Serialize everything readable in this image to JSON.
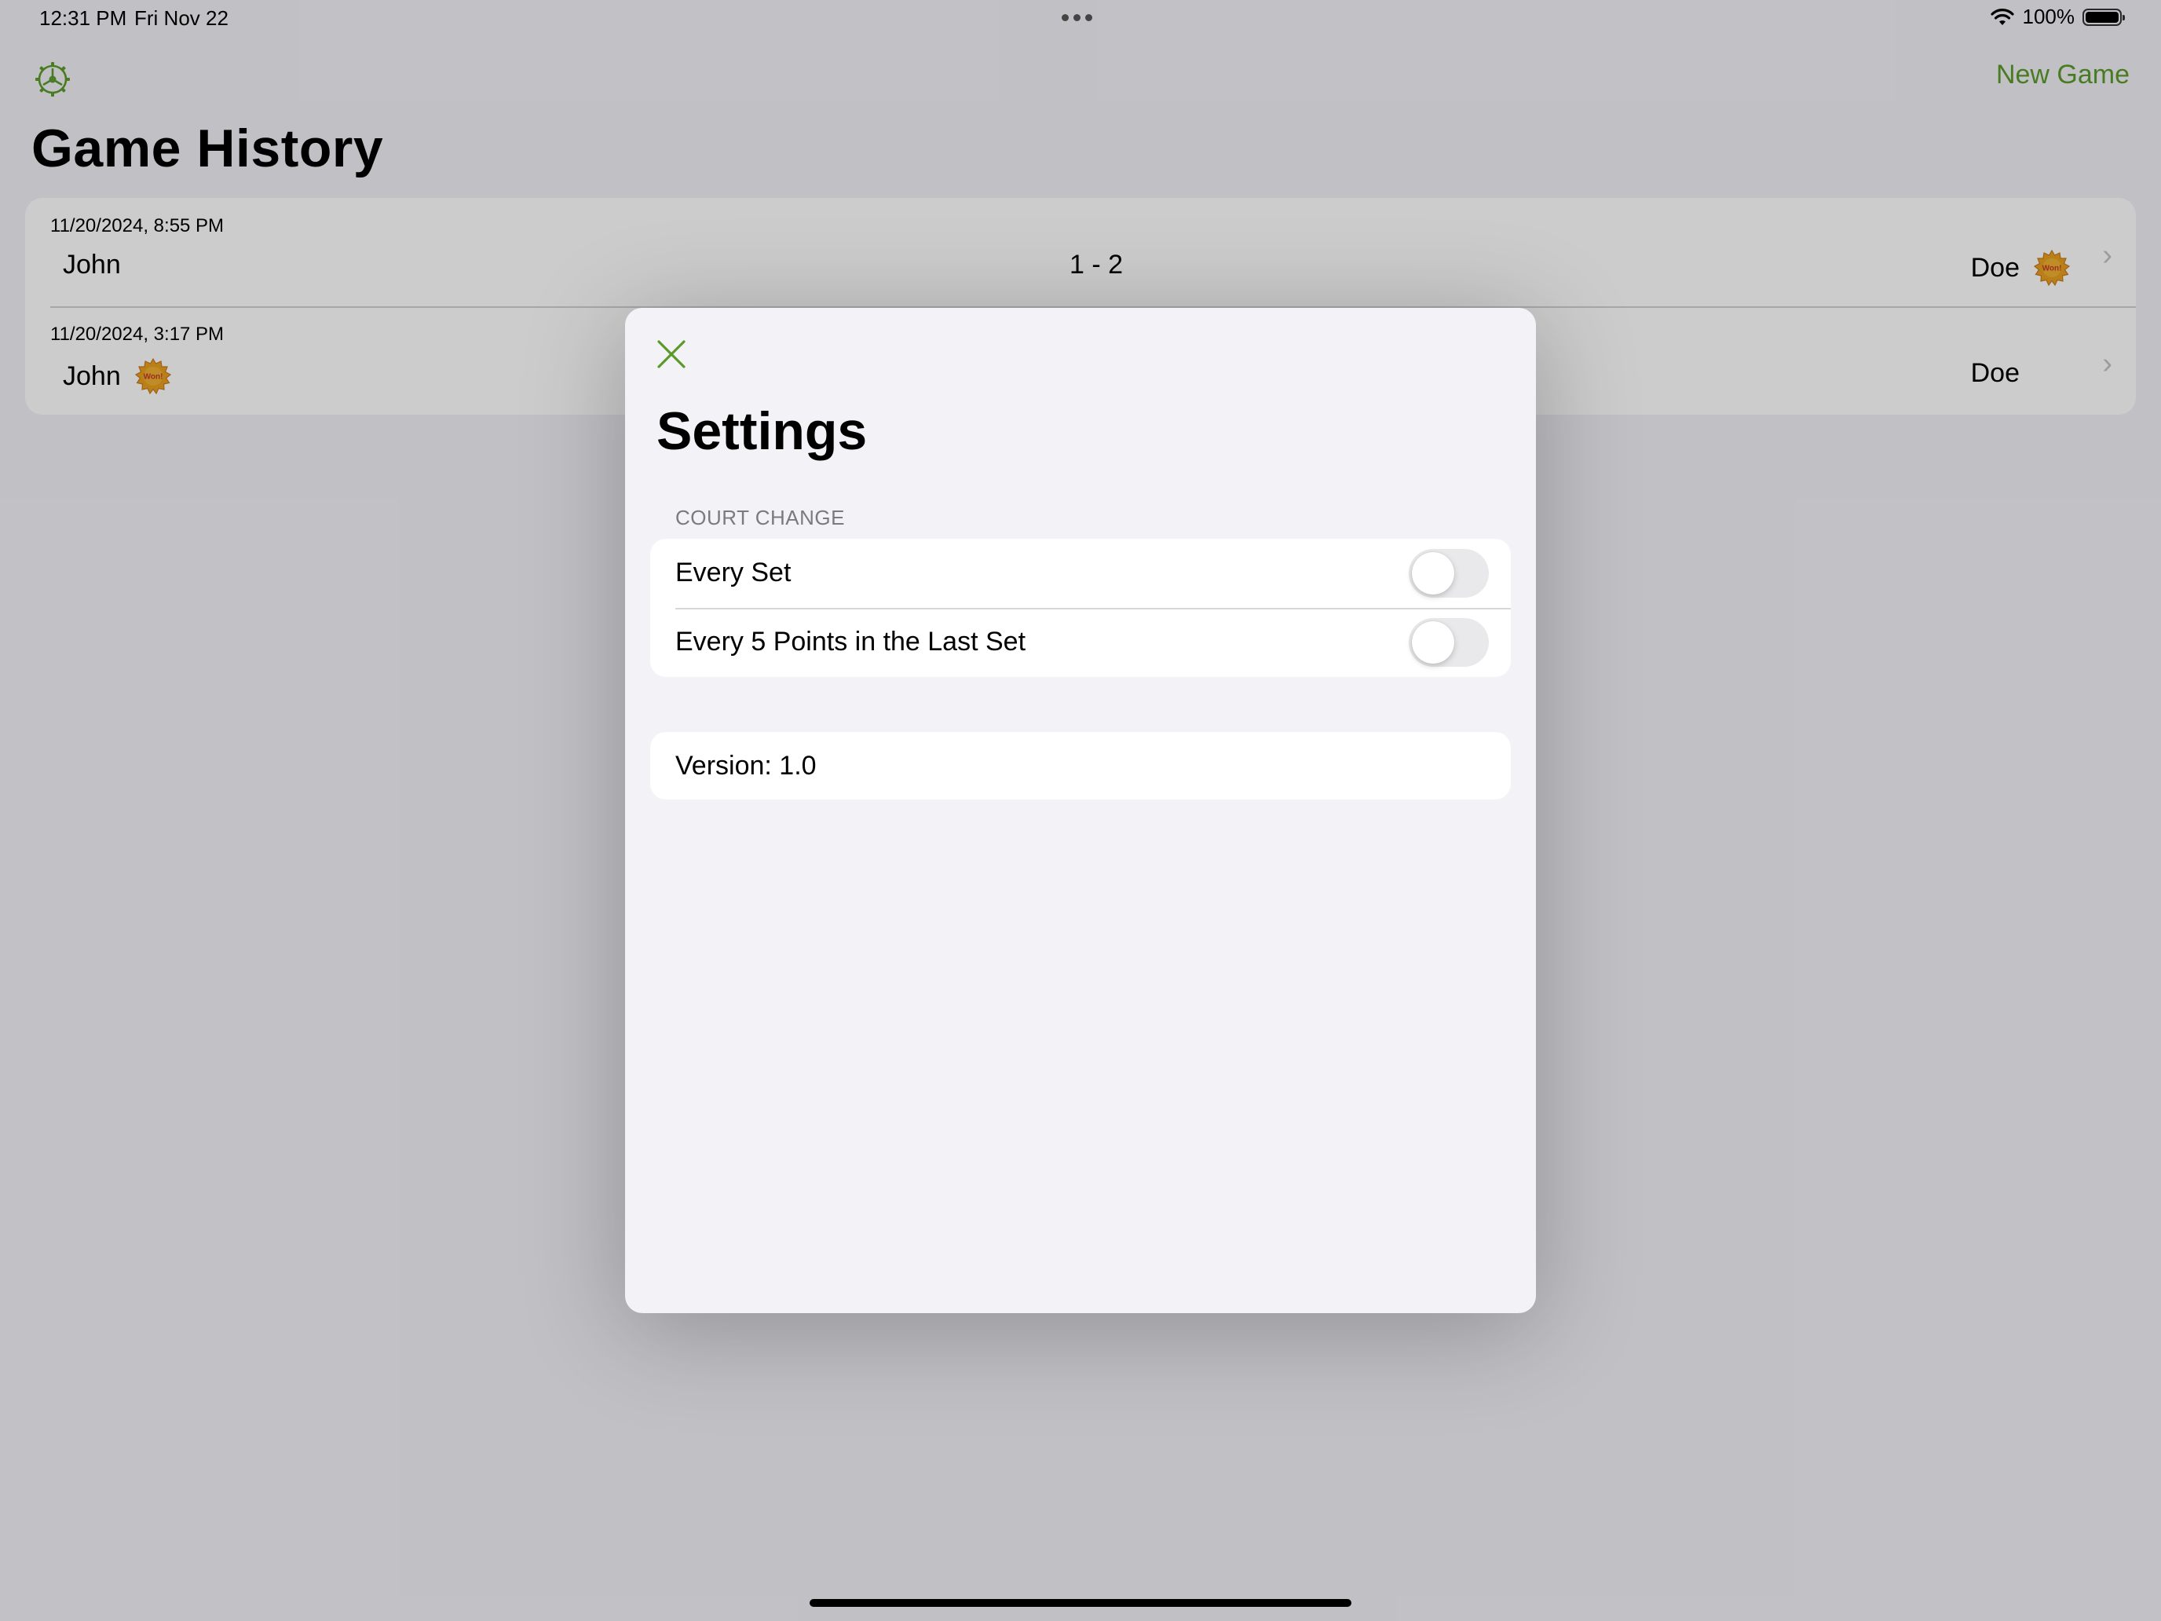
{
  "status_bar": {
    "time": "12:31 PM",
    "date": "Fri Nov 22",
    "battery": "100%"
  },
  "nav": {
    "settings_icon": "gear-icon",
    "new_game_label": "New Game"
  },
  "page": {
    "title": "Game History"
  },
  "history": [
    {
      "date": "11/20/2024, 8:55 PM",
      "player_left": "John",
      "score": "1 - 2",
      "player_right": "Doe",
      "winner": "right"
    },
    {
      "date": "11/20/2024, 3:17 PM",
      "player_left": "John",
      "score": "",
      "player_right": "Doe",
      "winner": "left"
    }
  ],
  "badge": {
    "label": "Won!"
  },
  "settings_modal": {
    "close_icon": "close-icon",
    "title": "Settings",
    "court_change": {
      "header": "COURT CHANGE",
      "items": [
        {
          "label": "Every Set",
          "enabled": false
        },
        {
          "label": "Every 5 Points in the Last Set",
          "enabled": false
        }
      ]
    },
    "version_text": "Version: 1.0"
  },
  "colors": {
    "accent": "#5a9a2b",
    "badge_fill": "#e8a020",
    "badge_text": "#c0392b"
  }
}
